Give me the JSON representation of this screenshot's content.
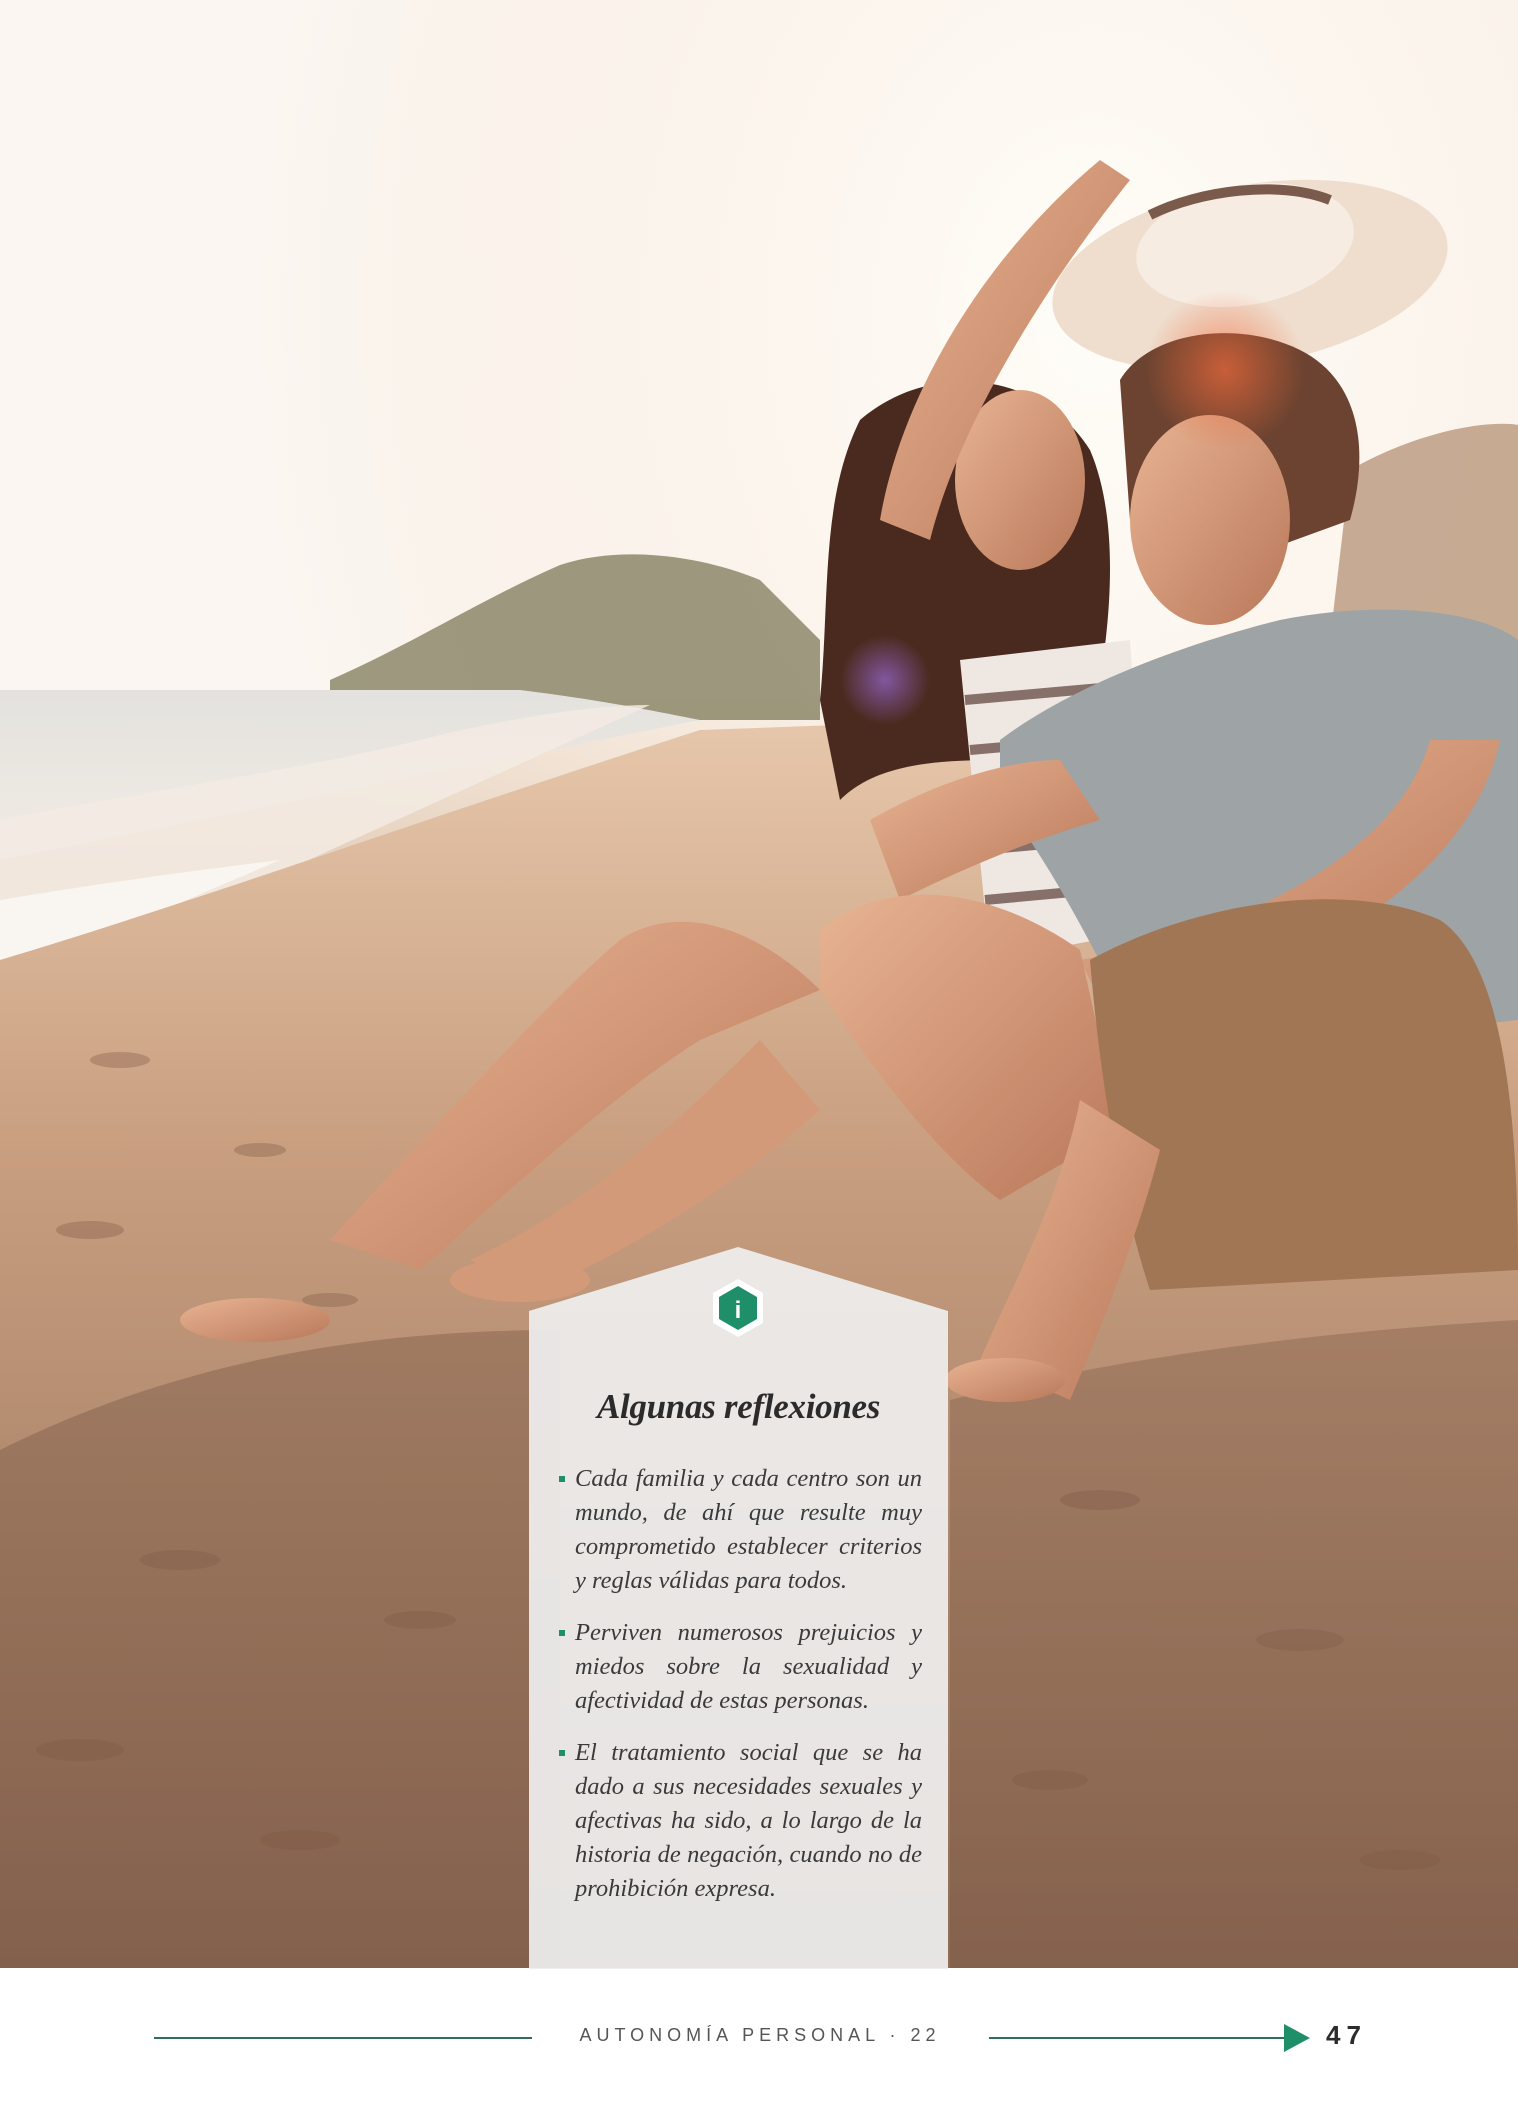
{
  "infobox": {
    "icon": "info-icon",
    "icon_glyph": "i",
    "title": "Algunas reflexiones",
    "items": [
      "Cada familia y cada centro son un mundo, de ahí que resulte muy comprometido establecer criterios y reglas válidas para todos.",
      "Perviven numerosos prejuicios y miedos sobre la sexualidad y afectividad de estas personas.",
      "El tratamiento social que se ha dado a sus necesidades sexuales y afectivas ha sido, a lo largo de la historia de negación, cuando no de prohibición expresa."
    ]
  },
  "footer": {
    "publication": "AUTONOMÍA PERSONAL · 22",
    "page_number": "47"
  },
  "colors": {
    "accent_green": "#1f8f6a",
    "footer_line": "#2d6f5a"
  }
}
